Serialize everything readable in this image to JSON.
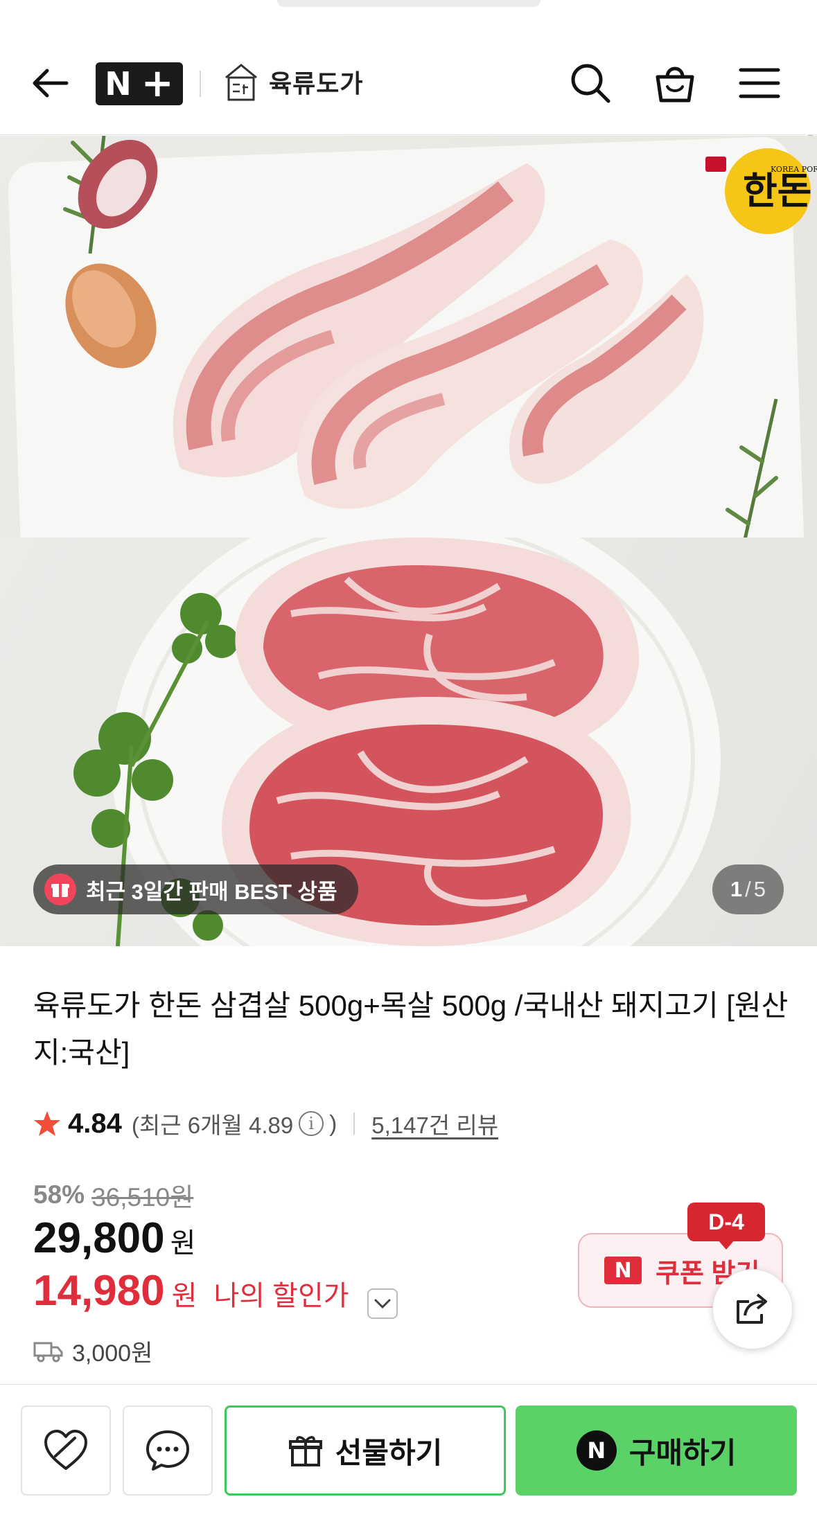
{
  "header": {
    "badge_n": "N",
    "badge_plus": "+",
    "brand_name": "육류도가",
    "brand_logo_text": "육류도가",
    "brand_color": "#1b1b1b"
  },
  "gallery": {
    "badge_text": "최근 3일간 판매 BEST 상품",
    "counter_current": "1",
    "counter_sep": "/",
    "counter_total": "5",
    "seal_text": "한돈",
    "seal_caption": "KOREA PORK"
  },
  "product": {
    "title": "육류도가 한돈 삼겹살 500g+목살 500g /국내산 돼지고기 [원산지:국산]",
    "rating": "4.84",
    "recent_rating": "(최근 6개월 4.89",
    "recent_close": ")",
    "review_count": "5,147건 리뷰",
    "discount_pct": "58%",
    "original_price": "36,510원",
    "price": "29,800",
    "price_unit": "원",
    "my_price": "14,980",
    "my_price_unit": "원",
    "my_price_label": "나의 할인가",
    "shipping": "3,000원"
  },
  "coupon": {
    "n_mark": "N",
    "label": "쿠폰 받기",
    "dday": "D-4"
  },
  "bottom_bar": {
    "gift_label": "선물하기",
    "buy_label": "구매하기",
    "buy_n_mark": "N",
    "accent_green": "#5bd268",
    "accent_red": "#e02d3b"
  }
}
